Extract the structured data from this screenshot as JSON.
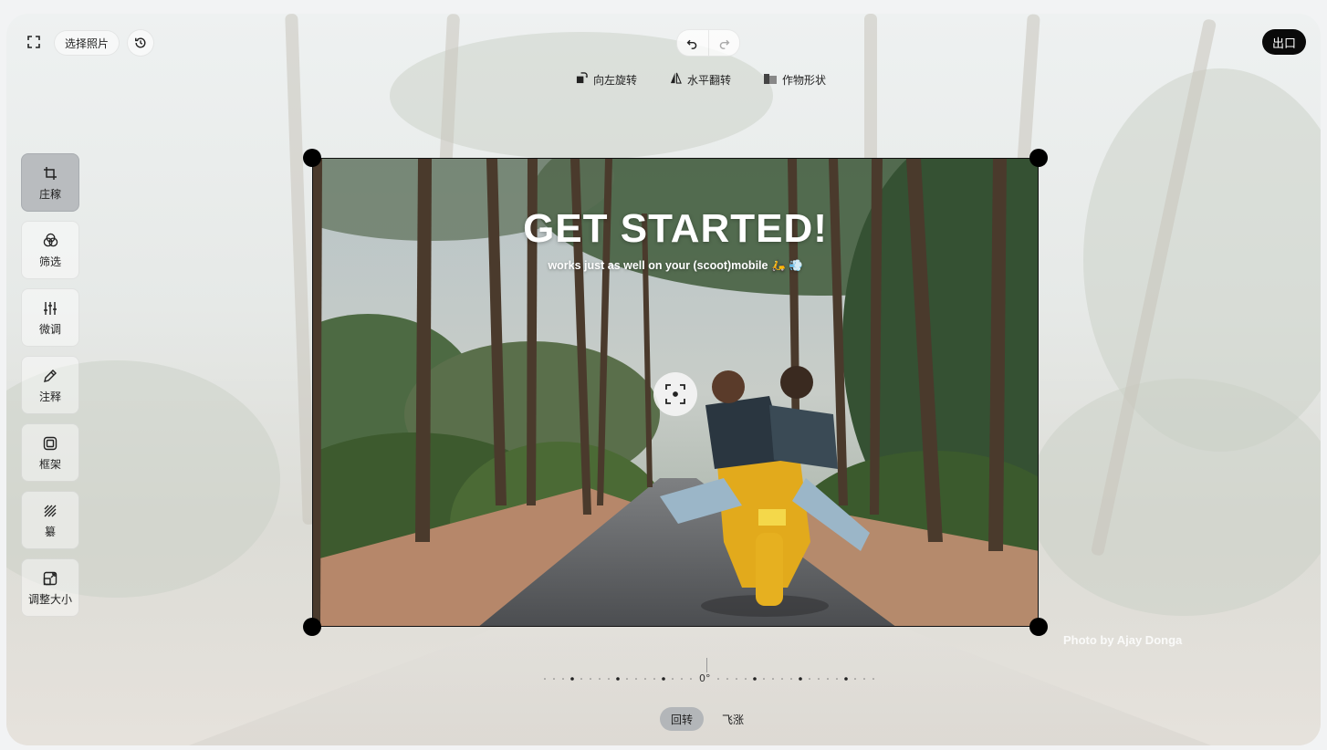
{
  "topbar": {
    "fullscreen_icon": "fullscreen-icon",
    "select_photo_label": "选择照片",
    "history_icon": "history-icon",
    "undo_icon": "undo-icon",
    "redo_icon": "redo-icon",
    "export_label": "出口"
  },
  "tools": [
    {
      "icon": "rotate-left-icon",
      "label": "向左旋转"
    },
    {
      "icon": "flip-horizontal-icon",
      "label": "水平翻转"
    },
    {
      "icon": "crop-shape-icon",
      "label": "作物形状"
    }
  ],
  "sidebar": {
    "items": [
      {
        "icon": "crop-icon",
        "label": "庄稼",
        "active": true
      },
      {
        "icon": "filter-icon",
        "label": "筛选",
        "active": false
      },
      {
        "icon": "sliders-icon",
        "label": "微调",
        "active": false
      },
      {
        "icon": "pencil-icon",
        "label": "注释",
        "active": false
      },
      {
        "icon": "frame-icon",
        "label": "框架",
        "active": false
      },
      {
        "icon": "texture-icon",
        "label": "纂",
        "active": false
      },
      {
        "icon": "resize-icon",
        "label": "调整大小",
        "active": false
      }
    ]
  },
  "photo": {
    "title": "GET STARTED!",
    "subtitle": "works just as well on your (scoot)mobile 🛵 💨",
    "watermark": "Photo by Ajay Donga"
  },
  "rotation": {
    "value_label": "0°"
  },
  "modes": [
    {
      "label": "回转",
      "active": true
    },
    {
      "label": "飞涨",
      "active": false
    }
  ],
  "colors": {
    "accent": "#0a0a0a",
    "active_tab": "#b3b6b9"
  }
}
